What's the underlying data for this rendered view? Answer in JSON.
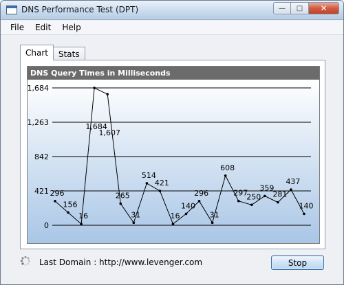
{
  "window": {
    "title": "DNS Performance Test (DPT)",
    "minimize_glyph": "—",
    "maximize_glyph": "□",
    "close_glyph": "✕"
  },
  "menu": {
    "items": [
      "File",
      "Edit",
      "Help"
    ]
  },
  "tabs": [
    {
      "label": "Chart",
      "active": true
    },
    {
      "label": "Stats",
      "active": false
    }
  ],
  "chart_data": {
    "type": "line",
    "title": "DNS Query Times in Milliseconds",
    "ylim": [
      0,
      1684
    ],
    "yticks": [
      0,
      421,
      842,
      1263,
      1684
    ],
    "ytick_labels": [
      "0",
      "421",
      "842",
      "1,263",
      "1,684"
    ],
    "grid": true,
    "values": [
      296,
      156,
      16,
      1684,
      1607,
      265,
      31,
      514,
      421,
      16,
      140,
      296,
      31,
      608,
      297,
      250,
      359,
      281,
      437,
      140
    ],
    "line_color": "#000000",
    "background_top": "#ffffff",
    "background_bottom": "#a9c6e6"
  },
  "status": {
    "last_domain_label": "Last Domain : http://www.levenger.com",
    "stop_label": "Stop"
  }
}
